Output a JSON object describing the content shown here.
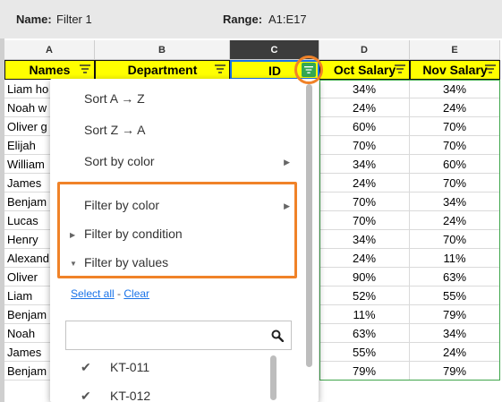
{
  "filter_bar": {
    "name_label": "Name:",
    "name_value": "Filter 1",
    "range_label": "Range:",
    "range_value": "A1:E17"
  },
  "columns": [
    "A",
    "B",
    "C",
    "D",
    "E"
  ],
  "headers": [
    "Names",
    "Department",
    "ID",
    "Oct Salary",
    "Nov Salary"
  ],
  "rows": [
    {
      "name": "Liam ho",
      "oct": "34%",
      "nov": "34%"
    },
    {
      "name": "Noah w",
      "oct": "24%",
      "nov": "24%"
    },
    {
      "name": "Oliver g",
      "oct": "60%",
      "nov": "70%"
    },
    {
      "name": "Elijah",
      "oct": "70%",
      "nov": "70%"
    },
    {
      "name": "William",
      "oct": "34%",
      "nov": "60%"
    },
    {
      "name": "James",
      "oct": "24%",
      "nov": "70%"
    },
    {
      "name": "Benjam",
      "oct": "70%",
      "nov": "34%"
    },
    {
      "name": "Lucas",
      "oct": "70%",
      "nov": "24%"
    },
    {
      "name": "Henry",
      "oct": "34%",
      "nov": "70%"
    },
    {
      "name": "Alexand",
      "oct": "24%",
      "nov": "11%"
    },
    {
      "name": "Oliver",
      "oct": "90%",
      "nov": "63%"
    },
    {
      "name": "Liam",
      "oct": "52%",
      "nov": "55%"
    },
    {
      "name": "Benjam",
      "oct": "11%",
      "nov": "79%"
    },
    {
      "name": "Noah",
      "oct": "63%",
      "nov": "34%"
    },
    {
      "name": "James",
      "oct": "55%",
      "nov": "24%"
    },
    {
      "name": "Benjam",
      "oct": "79%",
      "nov": "79%"
    }
  ],
  "menu": {
    "sort_az": "Sort A → Z",
    "sort_za": "Sort Z → A",
    "sort_by_color": "Sort by color",
    "filter_by_color": "Filter by color",
    "filter_by_condition": "Filter by condition",
    "filter_by_values": "Filter by values",
    "select_all": "Select all",
    "separator": " - ",
    "clear": "Clear",
    "search_icon": "search-icon",
    "values": [
      "KT-011",
      "KT-012"
    ]
  },
  "colors": {
    "header_fill": "#ffff00",
    "filter_active": "#34a853",
    "highlight": "#f08228",
    "link": "#1a73e8"
  }
}
